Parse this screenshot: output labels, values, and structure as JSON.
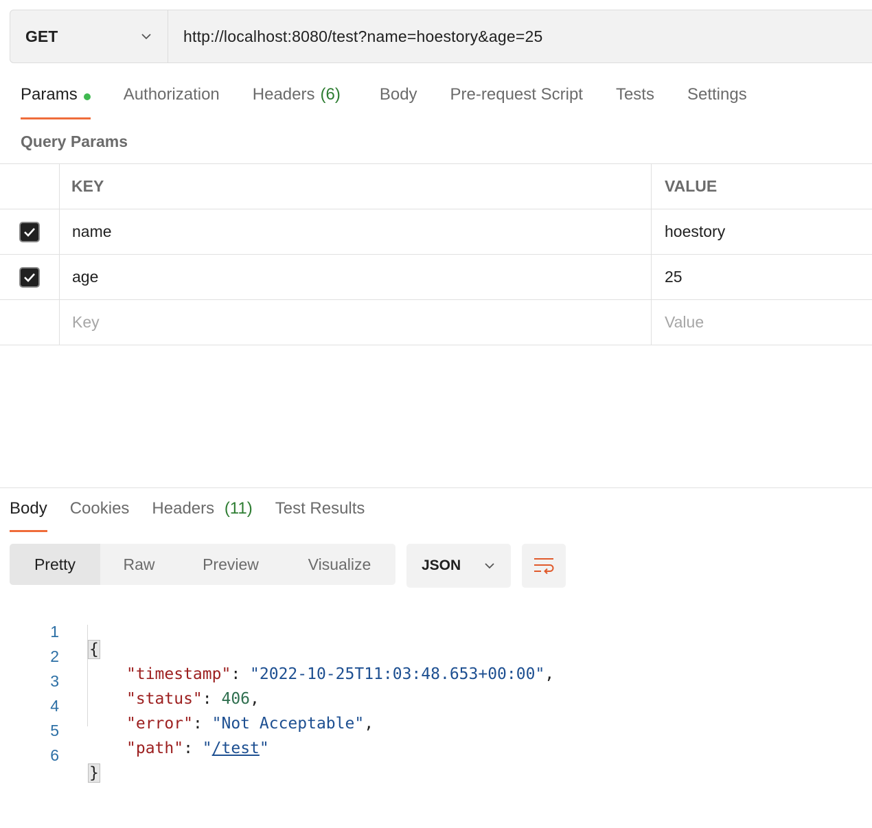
{
  "request": {
    "method": "GET",
    "url": "http://localhost:8080/test?name=hoestory&age=25"
  },
  "request_tabs": [
    {
      "label": "Params",
      "active": true,
      "dot": true
    },
    {
      "label": "Authorization"
    },
    {
      "label": "Headers",
      "count": "(6)"
    },
    {
      "label": "Body"
    },
    {
      "label": "Pre-request Script"
    },
    {
      "label": "Tests"
    },
    {
      "label": "Settings"
    }
  ],
  "query_params": {
    "title": "Query Params",
    "headers": {
      "key": "KEY",
      "value": "VALUE"
    },
    "rows": [
      {
        "checked": true,
        "key": "name",
        "value": "hoestory"
      },
      {
        "checked": true,
        "key": "age",
        "value": "25"
      }
    ],
    "placeholder": {
      "key": "Key",
      "value": "Value"
    }
  },
  "response_tabs": [
    {
      "label": "Body",
      "active": true
    },
    {
      "label": "Cookies"
    },
    {
      "label": "Headers",
      "count": "(11)"
    },
    {
      "label": "Test Results"
    }
  ],
  "view_modes": [
    "Pretty",
    "Raw",
    "Preview",
    "Visualize"
  ],
  "active_view": "Pretty",
  "format": "JSON",
  "colors": {
    "accent": "#ef6c3a",
    "dot": "#3fb950",
    "count": "#2e7d32"
  },
  "icons": {
    "method_dropdown": "chevron-down-icon",
    "format_dropdown": "chevron-down-icon",
    "wrap": "wrap-lines-icon",
    "checkbox": "check-icon"
  },
  "response_body": {
    "line_numbers": [
      "1",
      "2",
      "3",
      "4",
      "5",
      "6"
    ],
    "open_brace": "{",
    "close_brace": "}",
    "fields": [
      {
        "key": "\"timestamp\"",
        "value": "\"2022-10-25T11:03:48.653+00:00\"",
        "type": "string",
        "comma": ","
      },
      {
        "key": "\"status\"",
        "value": "406",
        "type": "number",
        "comma": ","
      },
      {
        "key": "\"error\"",
        "value": "\"Not Acceptable\"",
        "type": "string",
        "comma": ","
      },
      {
        "key": "\"path\"",
        "value_link": "/test",
        "type": "link",
        "comma": ""
      }
    ]
  }
}
